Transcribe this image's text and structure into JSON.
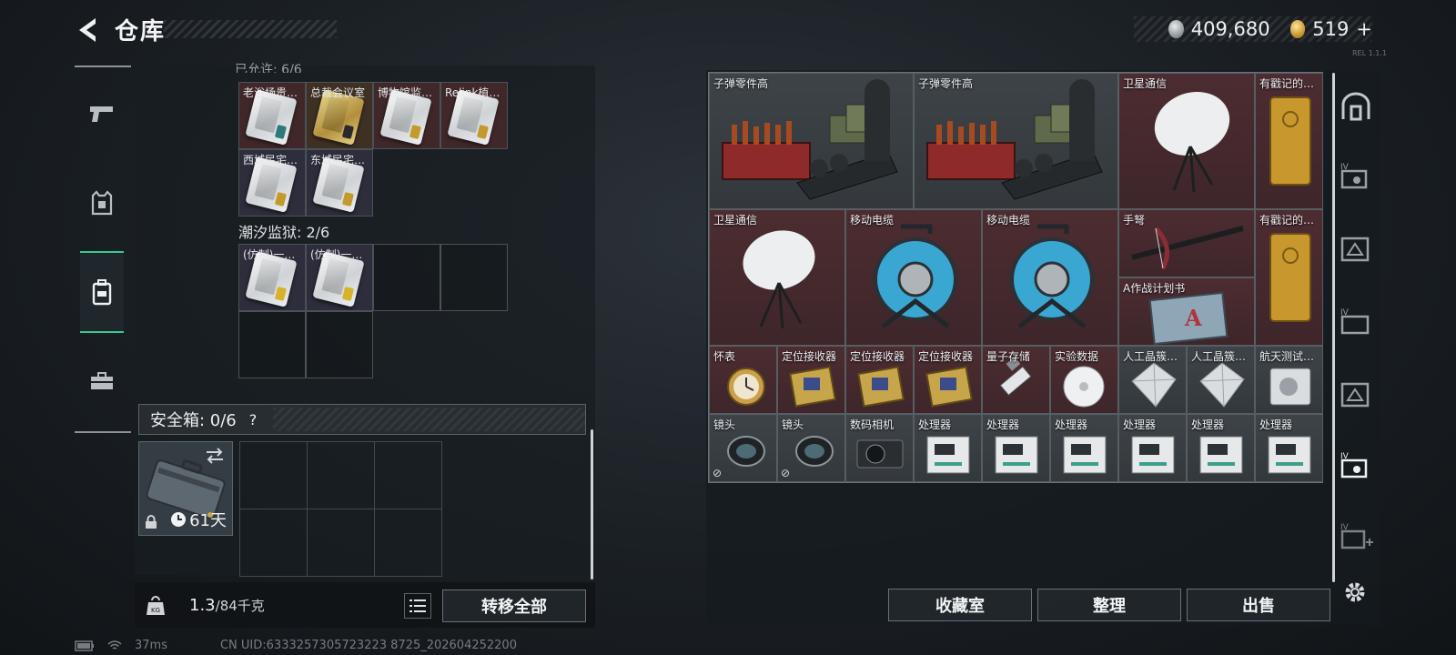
{
  "header": {
    "title": "仓库",
    "currency_silver": "409,680",
    "currency_gold": "519",
    "currency_plus": "+",
    "version": "REL 1.1.1"
  },
  "sidebar": {
    "tabs": [
      {
        "icon": "pistol-icon",
        "active": false
      },
      {
        "icon": "armor-vest-icon",
        "active": false
      },
      {
        "icon": "backpack-icon",
        "active": true
      },
      {
        "icon": "toolbox-icon",
        "active": false
      }
    ]
  },
  "container": {
    "top_partial_label": "已允许: 6/6",
    "cards_row1": [
      {
        "label": "老浴场贵…",
        "tint": "red",
        "tag": "#2d7a7a"
      },
      {
        "label": "总裁会议室",
        "tint": "gold",
        "tag": "#c49a2d"
      },
      {
        "label": "博物馆监…",
        "tint": "red",
        "tag": "#c49a2d"
      },
      {
        "label": "Relink植…",
        "tint": "red",
        "tag": "#c49a2d"
      }
    ],
    "cards_row2": [
      {
        "label": "西城民宅…",
        "tint": "purple",
        "tag": "#c49a2d"
      },
      {
        "label": "东城民宅…",
        "tint": "purple",
        "tag": "#c49a2d"
      }
    ],
    "prison_section": "潮汐监狱: 2/6",
    "prison_cards": [
      {
        "label": "(仿制)一…",
        "tint": "purple",
        "tag": "#d8b22a"
      },
      {
        "label": "(仿制)一…",
        "tint": "purple",
        "tag": "#d8b22a"
      }
    ],
    "safe_box_label": "安全箱: 0/6",
    "safe_help": "?",
    "case_days": "61天",
    "weight_current": "1.3",
    "weight_max": "/84千克",
    "transfer_all": "转移全部"
  },
  "storage": {
    "items": [
      {
        "label": "子弹零件高",
        "tint": "gray",
        "icon": "ammo-parts-crate-icon"
      },
      {
        "label": "子弹零件高",
        "tint": "gray",
        "icon": "ammo-parts-crate-icon"
      },
      {
        "label": "卫星通信",
        "tint": "red",
        "icon": "satellite-dish-icon"
      },
      {
        "label": "有戳记的…",
        "tint": "red",
        "icon": "gold-bar-icon"
      },
      {
        "label": "卫星通信",
        "tint": "red",
        "icon": "satellite-dish-icon"
      },
      {
        "label": "移动电缆",
        "tint": "red",
        "icon": "cable-reel-icon"
      },
      {
        "label": "移动电缆",
        "tint": "red",
        "icon": "cable-reel-icon"
      },
      {
        "label": "手弩",
        "tint": "red",
        "icon": "crossbow-icon"
      },
      {
        "label": "A作战计划书",
        "tint": "red",
        "icon": "battle-plan-icon"
      },
      {
        "label": "有戳记的…",
        "tint": "red",
        "icon": "gold-bar-icon"
      },
      {
        "label": "怀表",
        "tint": "red",
        "icon": "pocket-watch-icon"
      },
      {
        "label": "定位接收器",
        "tint": "red",
        "icon": "gps-receiver-icon"
      },
      {
        "label": "定位接收器",
        "tint": "red",
        "icon": "gps-receiver-icon"
      },
      {
        "label": "定位接收器",
        "tint": "red",
        "icon": "gps-receiver-icon"
      },
      {
        "label": "量子存储",
        "tint": "red",
        "icon": "quantum-storage-icon"
      },
      {
        "label": "实验数据",
        "tint": "red",
        "icon": "data-disc-icon"
      },
      {
        "label": "人工晶簇…",
        "tint": "gray",
        "icon": "crystal-icon"
      },
      {
        "label": "人工晶簇…",
        "tint": "gray",
        "icon": "crystal-icon"
      },
      {
        "label": "航天测试…",
        "tint": "gray",
        "icon": "aerospace-drive-icon"
      },
      {
        "label": "镜头",
        "tint": "gray",
        "icon": "camera-lens-icon"
      },
      {
        "label": "镜头",
        "tint": "gray",
        "icon": "camera-lens-icon"
      },
      {
        "label": "数码相机",
        "tint": "gray",
        "icon": "digital-camera-icon"
      },
      {
        "label": "处理器",
        "tint": "gray",
        "icon": "processor-icon"
      },
      {
        "label": "处理器",
        "tint": "gray",
        "icon": "processor-icon"
      },
      {
        "label": "处理器",
        "tint": "gray",
        "icon": "processor-icon"
      },
      {
        "label": "处理器",
        "tint": "gray",
        "icon": "processor-icon"
      },
      {
        "label": "处理器",
        "tint": "gray",
        "icon": "processor-icon"
      },
      {
        "label": "处理器",
        "tint": "gray",
        "icon": "processor-icon"
      }
    ],
    "buttons": {
      "collection": "收藏室",
      "organize": "整理",
      "sell": "出售"
    }
  },
  "rail": {
    "items": [
      {
        "icon": "vault-door-icon",
        "tier": ""
      },
      {
        "icon": "storage-iv-1-icon",
        "tier": "IV"
      },
      {
        "icon": "storage-triangle-icon",
        "tier": ""
      },
      {
        "icon": "storage-iv-2-icon",
        "tier": "IV"
      },
      {
        "icon": "storage-triangle-2-icon",
        "tier": ""
      },
      {
        "icon": "storage-iv-active-icon",
        "tier": "IV"
      },
      {
        "icon": "storage-iv-add-icon",
        "tier": "IV"
      }
    ]
  },
  "status": {
    "ping": "37ms",
    "uid": "CN UID:6333257305723223 8725_202604252200"
  }
}
